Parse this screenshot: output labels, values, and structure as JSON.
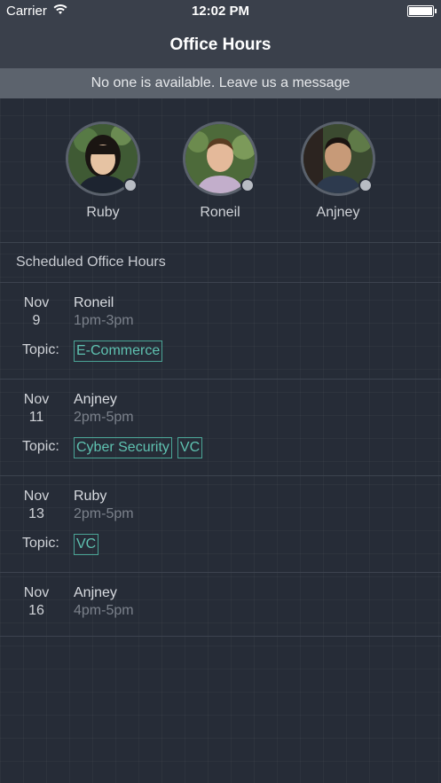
{
  "status_bar": {
    "carrier": "Carrier",
    "time": "12:02 PM"
  },
  "nav": {
    "title": "Office Hours"
  },
  "banner": {
    "text": "No one is available. Leave us a message"
  },
  "advisors": [
    {
      "name": "Ruby",
      "status": "offline"
    },
    {
      "name": "Roneil",
      "status": "offline"
    },
    {
      "name": "Anjney",
      "status": "offline"
    }
  ],
  "schedule": {
    "title": "Scheduled Office Hours",
    "topic_label": "Topic:",
    "sessions": [
      {
        "month": "Nov",
        "day": "9",
        "host": "Roneil",
        "hours": "1pm-3pm",
        "topics": [
          "E-Commerce"
        ]
      },
      {
        "month": "Nov",
        "day": "11",
        "host": "Anjney",
        "hours": "2pm-5pm",
        "topics": [
          "Cyber Security",
          "VC"
        ]
      },
      {
        "month": "Nov",
        "day": "13",
        "host": "Ruby",
        "hours": "2pm-5pm",
        "topics": [
          "VC"
        ]
      },
      {
        "month": "Nov",
        "day": "16",
        "host": "Anjney",
        "hours": "4pm-5pm",
        "topics": []
      }
    ]
  },
  "colors": {
    "background": "#262c37",
    "nav": "#3a404b",
    "banner": "#5c636d",
    "tag": "#5fc2b1",
    "muted": "#7b818b"
  },
  "icons": [
    "wifi-icon",
    "battery-icon",
    "presence-dot-icon"
  ]
}
